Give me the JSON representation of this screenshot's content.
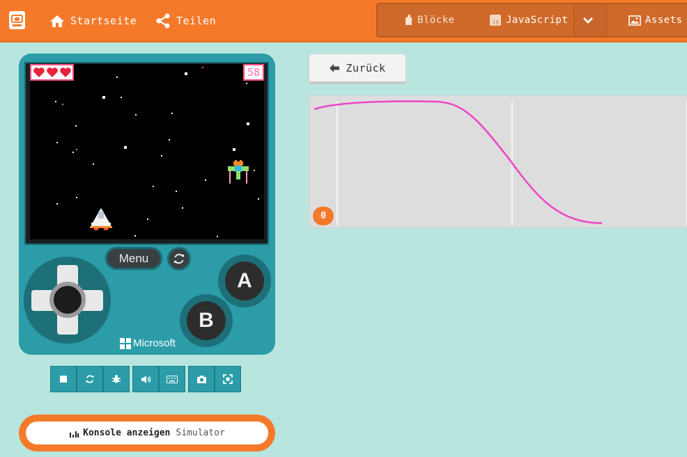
{
  "header": {
    "home_label": "Startseite",
    "share_label": "Teilen",
    "editor_tabs": {
      "blocks_label": "Blöcke",
      "javascript_label": "JavaScript",
      "assets_label": "Assets"
    }
  },
  "simulator": {
    "hearts": 3,
    "score": "58",
    "menu_label": "Menu",
    "a_label": "A",
    "b_label": "B",
    "brand": "Microsoft",
    "toolbar": [
      {
        "name": "stop-icon"
      },
      {
        "name": "restart-icon"
      },
      {
        "name": "debug-icon"
      },
      {
        "name": "sound-icon"
      },
      {
        "name": "keyboard-icon"
      },
      {
        "name": "screenshot-icon"
      },
      {
        "name": "fullscreen-icon"
      }
    ],
    "console_button": {
      "label_bold": "Konsole anzeigen",
      "label_light": "Simulator"
    }
  },
  "editor": {
    "back_label": "Zurück",
    "time_marker": "0",
    "curve_color": "#ee44c6"
  },
  "colors": {
    "accent": "#f47a2a",
    "console_teal": "#2b9ca8",
    "background": "#b8e6de"
  }
}
